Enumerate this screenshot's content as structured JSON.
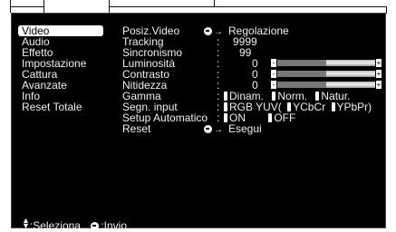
{
  "menu": {
    "items": [
      {
        "label": "Video",
        "selected": true
      },
      {
        "label": "Audio",
        "selected": false
      },
      {
        "label": "Effetto",
        "selected": false
      },
      {
        "label": "Impostazione",
        "selected": false
      },
      {
        "label": "Cattura",
        "selected": false
      },
      {
        "label": "Avanzate",
        "selected": false
      },
      {
        "label": "Info",
        "selected": false
      },
      {
        "label": "Reset Totale",
        "selected": false
      }
    ]
  },
  "params": {
    "posiz": {
      "label": "Posiz.Video",
      "action": "Regolazione"
    },
    "tracking": {
      "label": "Tracking",
      "colon": ":",
      "value": "9999"
    },
    "sinc": {
      "label": "Sincronismo",
      "colon": ":",
      "value": "99"
    },
    "lum": {
      "label": "Luminosità",
      "colon": ":",
      "value": "0",
      "level": 0.5
    },
    "contr": {
      "label": "Contrasto",
      "colon": ":",
      "value": "0",
      "level": 0.5
    },
    "nit": {
      "label": "Nitidezza",
      "colon": ":",
      "value": "0",
      "level": 0.5
    },
    "gamma": {
      "label": "Gamma",
      "colon": ":",
      "options": [
        "Dinam.",
        "Norm.",
        "Natur."
      ]
    },
    "segn": {
      "label": "Segn. input",
      "colon": ":",
      "options": [
        "RGB YUV(",
        "YCbCr",
        "YPbPr)"
      ]
    },
    "setup": {
      "label": "Setup Automatico",
      "colon": ":",
      "options": [
        "ON",
        "OFF"
      ]
    },
    "reset": {
      "label": "Reset",
      "action": "Esegui"
    }
  },
  "footer": {
    "select": ":Seleziona",
    "enter": ":Invio"
  },
  "slider_ends": {
    "minus": "-",
    "plus": "+"
  }
}
